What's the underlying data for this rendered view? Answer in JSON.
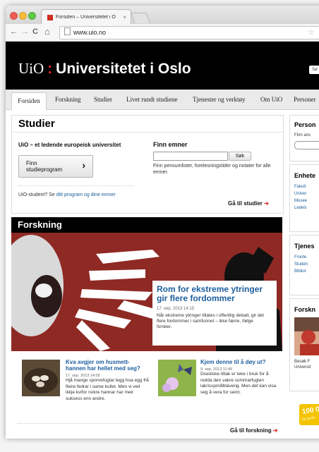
{
  "browser": {
    "tab_title": "Forsiden – Universitetet i O",
    "tab_close": "×",
    "url": "www.uio.no",
    "back": "←",
    "forward": "→",
    "reload": "C",
    "home": "⌂",
    "star": "☆"
  },
  "header": {
    "logo_short": "UiO",
    "logo_colon": ":",
    "logo_name": "Universitetet i Oslo",
    "search_placeholder": "Sø"
  },
  "menu": [
    "Forsiden",
    "Forskning",
    "Studier",
    "Livet rundt studiene",
    "Tjenester og verktøy",
    "Om UiO",
    "Personer"
  ],
  "studier": {
    "title": "Studier",
    "tagline": "UiO – et ledende europeisk universitet",
    "find_program_line1": "Finn",
    "find_program_line2": "studieprogram",
    "find_program_arrow": "›",
    "find_courses_title": "Finn emner",
    "search_button": "Søk",
    "courses_hint": "Finn pensumlister, forelesningstider og notater for alle emner.",
    "student_prompt": "UiO-student? Se",
    "student_link": "ditt program og dine emner",
    "goto": "Gå til studier",
    "goto_arrow": "➔"
  },
  "forskning": {
    "title": "Forskning",
    "feature": {
      "headline": "Rom for ekstreme ytringer gir flere fordommer",
      "date": "17. sep. 2013 14:15",
      "summary": "Når ekstreme ytringer tillates i offentlig debatt, gir det flere fordommer i samfunnet – ikke færre, ifølge forsker."
    },
    "articles": [
      {
        "headline": "Kva avgjer om husmett-hannen har hellet med seg?",
        "date": "17. sep. 2013 14:05",
        "summary": "Hjå mange sporvefuglar legg hoa egg frå fleire fedrar i same kullet. Men vi veit ikkje kvifor nokre hannar har meir suksess enn andre."
      },
      {
        "headline": "Kjem denne til å døy ut?",
        "date": "9. sep. 2013 11:45",
        "summary": "Drastiske tiltak er teke i bruk for å redda den vakre sommarfuglen lakrisspmillbláveng. Men det kan visa seg å vera for seint."
      }
    ],
    "goto": "Gå til forskning",
    "goto_arrow": "➔"
  },
  "sidebar": {
    "persons_title": "Person",
    "persons_hint": "Finn ans",
    "units_title": "Enhete",
    "units_items": [
      "Fakult",
      "Univer",
      "Musee",
      "Ledels"
    ],
    "services_title": "Tjenes",
    "services_items": [
      "Fronte",
      "Studen",
      "Bibliot"
    ],
    "research_title": "Forskn",
    "research_caption_1": "Besøk F",
    "research_caption_2": "Universit",
    "promo_text": "100 0",
    "promo_sub": "for besø"
  }
}
